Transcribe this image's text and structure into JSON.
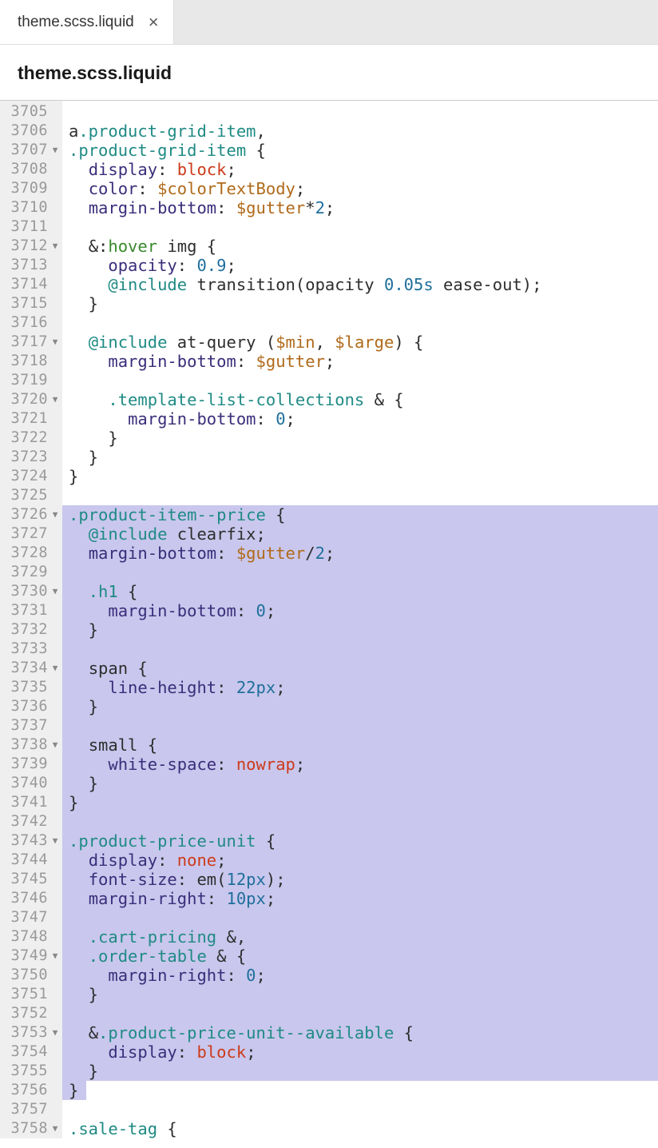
{
  "tab": {
    "label": "theme.scss.liquid"
  },
  "breadcrumb": {
    "title": "theme.scss.liquid"
  },
  "editor": {
    "first_line": 3705,
    "fold_lines": [
      3707,
      3712,
      3717,
      3720,
      3726,
      3730,
      3734,
      3738,
      3743,
      3749,
      3753,
      3758
    ],
    "selection": {
      "start": 3726,
      "end": 3756,
      "end_partial": true
    },
    "lines": {
      "3705": [],
      "3706": [
        {
          "t": "a",
          "c": "c-plain"
        },
        {
          "t": ".product-grid-item",
          "c": "c-sel"
        },
        {
          "t": ",",
          "c": "c-pun"
        }
      ],
      "3707": [
        {
          "t": ".product-grid-item",
          "c": "c-sel"
        },
        {
          "t": " {",
          "c": "c-pun"
        }
      ],
      "3708": [
        {
          "t": "  ",
          "c": "c-pun"
        },
        {
          "t": "display",
          "c": "c-prop"
        },
        {
          "t": ": ",
          "c": "c-pun"
        },
        {
          "t": "block",
          "c": "c-val"
        },
        {
          "t": ";",
          "c": "c-pun"
        }
      ],
      "3709": [
        {
          "t": "  ",
          "c": "c-pun"
        },
        {
          "t": "color",
          "c": "c-prop"
        },
        {
          "t": ": ",
          "c": "c-pun"
        },
        {
          "t": "$colorTextBody",
          "c": "c-var"
        },
        {
          "t": ";",
          "c": "c-pun"
        }
      ],
      "3710": [
        {
          "t": "  ",
          "c": "c-pun"
        },
        {
          "t": "margin-bottom",
          "c": "c-prop"
        },
        {
          "t": ": ",
          "c": "c-pun"
        },
        {
          "t": "$gutter",
          "c": "c-var"
        },
        {
          "t": "*",
          "c": "c-pun"
        },
        {
          "t": "2",
          "c": "c-num"
        },
        {
          "t": ";",
          "c": "c-pun"
        }
      ],
      "3711": [],
      "3712": [
        {
          "t": "  ",
          "c": "c-pun"
        },
        {
          "t": "&",
          "c": "c-amp"
        },
        {
          "t": ":",
          "c": "c-pun"
        },
        {
          "t": "hover",
          "c": "c-kw"
        },
        {
          "t": " ",
          "c": "c-pun"
        },
        {
          "t": "img",
          "c": "c-plain"
        },
        {
          "t": " {",
          "c": "c-pun"
        }
      ],
      "3713": [
        {
          "t": "    ",
          "c": "c-pun"
        },
        {
          "t": "opacity",
          "c": "c-prop"
        },
        {
          "t": ": ",
          "c": "c-pun"
        },
        {
          "t": "0.9",
          "c": "c-num"
        },
        {
          "t": ";",
          "c": "c-pun"
        }
      ],
      "3714": [
        {
          "t": "    ",
          "c": "c-pun"
        },
        {
          "t": "@include",
          "c": "c-at"
        },
        {
          "t": " ",
          "c": "c-pun"
        },
        {
          "t": "transition",
          "c": "c-fn"
        },
        {
          "t": "(",
          "c": "c-pun"
        },
        {
          "t": "opacity ",
          "c": "c-fn"
        },
        {
          "t": "0.05s",
          "c": "c-num"
        },
        {
          "t": " ease-out",
          "c": "c-fn"
        },
        {
          "t": ");",
          "c": "c-pun"
        }
      ],
      "3715": [
        {
          "t": "  }",
          "c": "c-pun"
        }
      ],
      "3716": [],
      "3717": [
        {
          "t": "  ",
          "c": "c-pun"
        },
        {
          "t": "@include",
          "c": "c-at"
        },
        {
          "t": " ",
          "c": "c-pun"
        },
        {
          "t": "at-query ",
          "c": "c-fn"
        },
        {
          "t": "(",
          "c": "c-pun"
        },
        {
          "t": "$min",
          "c": "c-var"
        },
        {
          "t": ", ",
          "c": "c-pun"
        },
        {
          "t": "$large",
          "c": "c-var"
        },
        {
          "t": ") {",
          "c": "c-pun"
        }
      ],
      "3718": [
        {
          "t": "    ",
          "c": "c-pun"
        },
        {
          "t": "margin-bottom",
          "c": "c-prop"
        },
        {
          "t": ": ",
          "c": "c-pun"
        },
        {
          "t": "$gutter",
          "c": "c-var"
        },
        {
          "t": ";",
          "c": "c-pun"
        }
      ],
      "3719": [],
      "3720": [
        {
          "t": "    ",
          "c": "c-pun"
        },
        {
          "t": ".template-list-collections",
          "c": "c-sel"
        },
        {
          "t": " ",
          "c": "c-pun"
        },
        {
          "t": "&",
          "c": "c-amp"
        },
        {
          "t": " {",
          "c": "c-pun"
        }
      ],
      "3721": [
        {
          "t": "      ",
          "c": "c-pun"
        },
        {
          "t": "margin-bottom",
          "c": "c-prop"
        },
        {
          "t": ": ",
          "c": "c-pun"
        },
        {
          "t": "0",
          "c": "c-num"
        },
        {
          "t": ";",
          "c": "c-pun"
        }
      ],
      "3722": [
        {
          "t": "    }",
          "c": "c-pun"
        }
      ],
      "3723": [
        {
          "t": "  }",
          "c": "c-pun"
        }
      ],
      "3724": [
        {
          "t": "}",
          "c": "c-pun"
        }
      ],
      "3725": [],
      "3726": [
        {
          "t": ".product-item--price",
          "c": "c-sel"
        },
        {
          "t": " {",
          "c": "c-pun"
        }
      ],
      "3727": [
        {
          "t": "  ",
          "c": "c-pun"
        },
        {
          "t": "@include",
          "c": "c-at"
        },
        {
          "t": " ",
          "c": "c-pun"
        },
        {
          "t": "clearfix",
          "c": "c-fn"
        },
        {
          "t": ";",
          "c": "c-pun"
        }
      ],
      "3728": [
        {
          "t": "  ",
          "c": "c-pun"
        },
        {
          "t": "margin-bottom",
          "c": "c-prop"
        },
        {
          "t": ": ",
          "c": "c-pun"
        },
        {
          "t": "$gutter",
          "c": "c-var"
        },
        {
          "t": "/",
          "c": "c-pun"
        },
        {
          "t": "2",
          "c": "c-num"
        },
        {
          "t": ";",
          "c": "c-pun"
        }
      ],
      "3729": [],
      "3730": [
        {
          "t": "  ",
          "c": "c-pun"
        },
        {
          "t": ".h1",
          "c": "c-sel"
        },
        {
          "t": " {",
          "c": "c-pun"
        }
      ],
      "3731": [
        {
          "t": "    ",
          "c": "c-pun"
        },
        {
          "t": "margin-bottom",
          "c": "c-prop"
        },
        {
          "t": ": ",
          "c": "c-pun"
        },
        {
          "t": "0",
          "c": "c-num"
        },
        {
          "t": ";",
          "c": "c-pun"
        }
      ],
      "3732": [
        {
          "t": "  }",
          "c": "c-pun"
        }
      ],
      "3733": [],
      "3734": [
        {
          "t": "  ",
          "c": "c-pun"
        },
        {
          "t": "span",
          "c": "c-plain"
        },
        {
          "t": " {",
          "c": "c-pun"
        }
      ],
      "3735": [
        {
          "t": "    ",
          "c": "c-pun"
        },
        {
          "t": "line-height",
          "c": "c-prop"
        },
        {
          "t": ": ",
          "c": "c-pun"
        },
        {
          "t": "22px",
          "c": "c-num"
        },
        {
          "t": ";",
          "c": "c-pun"
        }
      ],
      "3736": [
        {
          "t": "  }",
          "c": "c-pun"
        }
      ],
      "3737": [],
      "3738": [
        {
          "t": "  ",
          "c": "c-pun"
        },
        {
          "t": "small",
          "c": "c-plain"
        },
        {
          "t": " {",
          "c": "c-pun"
        }
      ],
      "3739": [
        {
          "t": "    ",
          "c": "c-pun"
        },
        {
          "t": "white-space",
          "c": "c-prop"
        },
        {
          "t": ": ",
          "c": "c-pun"
        },
        {
          "t": "nowrap",
          "c": "c-val"
        },
        {
          "t": ";",
          "c": "c-pun"
        }
      ],
      "3740": [
        {
          "t": "  }",
          "c": "c-pun"
        }
      ],
      "3741": [
        {
          "t": "}",
          "c": "c-pun"
        }
      ],
      "3742": [],
      "3743": [
        {
          "t": ".product-price-unit",
          "c": "c-sel"
        },
        {
          "t": " {",
          "c": "c-pun"
        }
      ],
      "3744": [
        {
          "t": "  ",
          "c": "c-pun"
        },
        {
          "t": "display",
          "c": "c-prop"
        },
        {
          "t": ": ",
          "c": "c-pun"
        },
        {
          "t": "none",
          "c": "c-val"
        },
        {
          "t": ";",
          "c": "c-pun"
        }
      ],
      "3745": [
        {
          "t": "  ",
          "c": "c-pun"
        },
        {
          "t": "font-size",
          "c": "c-prop"
        },
        {
          "t": ": ",
          "c": "c-pun"
        },
        {
          "t": "em",
          "c": "c-fn"
        },
        {
          "t": "(",
          "c": "c-pun"
        },
        {
          "t": "12px",
          "c": "c-num"
        },
        {
          "t": ");",
          "c": "c-pun"
        }
      ],
      "3746": [
        {
          "t": "  ",
          "c": "c-pun"
        },
        {
          "t": "margin-right",
          "c": "c-prop"
        },
        {
          "t": ": ",
          "c": "c-pun"
        },
        {
          "t": "10px",
          "c": "c-num"
        },
        {
          "t": ";",
          "c": "c-pun"
        }
      ],
      "3747": [],
      "3748": [
        {
          "t": "  ",
          "c": "c-pun"
        },
        {
          "t": ".cart-pricing",
          "c": "c-sel"
        },
        {
          "t": " ",
          "c": "c-pun"
        },
        {
          "t": "&",
          "c": "c-amp"
        },
        {
          "t": ",",
          "c": "c-pun"
        }
      ],
      "3749": [
        {
          "t": "  ",
          "c": "c-pun"
        },
        {
          "t": ".order-table",
          "c": "c-sel"
        },
        {
          "t": " ",
          "c": "c-pun"
        },
        {
          "t": "&",
          "c": "c-amp"
        },
        {
          "t": " {",
          "c": "c-pun"
        }
      ],
      "3750": [
        {
          "t": "    ",
          "c": "c-pun"
        },
        {
          "t": "margin-right",
          "c": "c-prop"
        },
        {
          "t": ": ",
          "c": "c-pun"
        },
        {
          "t": "0",
          "c": "c-num"
        },
        {
          "t": ";",
          "c": "c-pun"
        }
      ],
      "3751": [
        {
          "t": "  }",
          "c": "c-pun"
        }
      ],
      "3752": [],
      "3753": [
        {
          "t": "  ",
          "c": "c-pun"
        },
        {
          "t": "&",
          "c": "c-amp"
        },
        {
          "t": ".product-price-unit--available",
          "c": "c-sel"
        },
        {
          "t": " {",
          "c": "c-pun"
        }
      ],
      "3754": [
        {
          "t": "    ",
          "c": "c-pun"
        },
        {
          "t": "display",
          "c": "c-prop"
        },
        {
          "t": ": ",
          "c": "c-pun"
        },
        {
          "t": "block",
          "c": "c-val"
        },
        {
          "t": ";",
          "c": "c-pun"
        }
      ],
      "3755": [
        {
          "t": "  }",
          "c": "c-pun"
        }
      ],
      "3756": [
        {
          "t": "}",
          "c": "c-pun"
        }
      ],
      "3757": [],
      "3758": [
        {
          "t": ".sale-tag",
          "c": "c-sel"
        },
        {
          "t": " {",
          "c": "c-pun"
        }
      ]
    }
  }
}
